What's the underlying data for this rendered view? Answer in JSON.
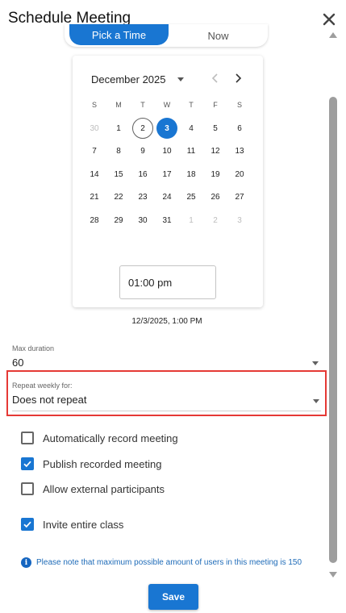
{
  "dialog": {
    "title": "Schedule Meeting"
  },
  "mode_toggle": {
    "options": [
      "Pick a Time",
      "Now"
    ],
    "selected": "Pick a Time"
  },
  "calendar": {
    "month_label": "December 2025",
    "weekdays": [
      "S",
      "M",
      "T",
      "W",
      "T",
      "F",
      "S"
    ],
    "weeks": [
      [
        "30",
        "1",
        "2",
        "3",
        "4",
        "5",
        "6"
      ],
      [
        "7",
        "8",
        "9",
        "10",
        "11",
        "12",
        "13"
      ],
      [
        "14",
        "15",
        "16",
        "17",
        "18",
        "19",
        "20"
      ],
      [
        "21",
        "22",
        "23",
        "24",
        "25",
        "26",
        "27"
      ],
      [
        "28",
        "29",
        "30",
        "31",
        "1",
        "2",
        "3"
      ]
    ],
    "today": "2",
    "selected": "3",
    "time_value": "01:00 pm"
  },
  "summary": {
    "datetime": "12/3/2025, 1:00 PM"
  },
  "max_duration": {
    "label": "Max duration",
    "value": "60"
  },
  "repeat": {
    "label": "Repeat weekly for:",
    "value": "Does not repeat"
  },
  "options": [
    {
      "label": "Automatically record meeting",
      "checked": false
    },
    {
      "label": "Publish recorded meeting",
      "checked": true
    },
    {
      "label": "Allow external participants",
      "checked": false
    },
    {
      "label": "Invite entire class",
      "checked": true
    }
  ],
  "note": {
    "icon": "info-icon",
    "text": "Please note that maximum possible amount of users in this meeting is 150"
  },
  "actions": {
    "save_label": "Save"
  },
  "colors": {
    "accent": "#1976d2",
    "highlight_border": "#e53935",
    "note_text": "#1e6bb8"
  }
}
